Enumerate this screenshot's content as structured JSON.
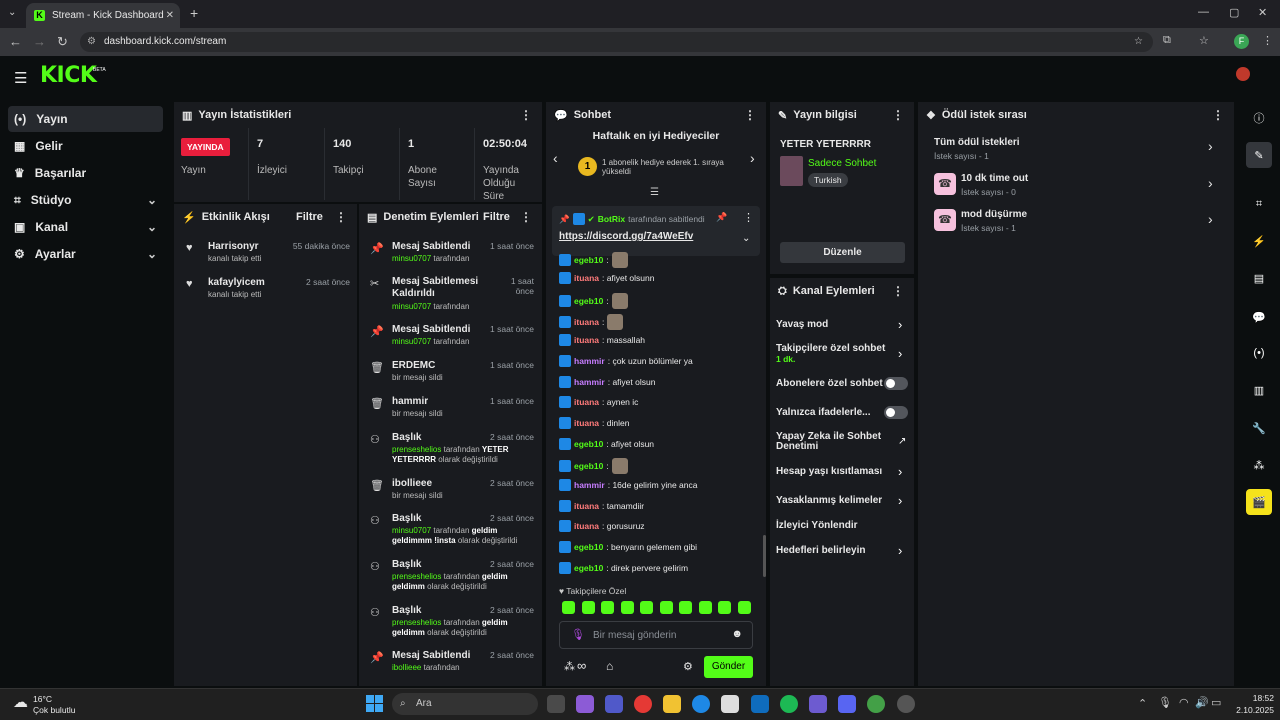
{
  "browser": {
    "tab_title": "Stream - Kick Dashboard",
    "url": "dashboard.kick.com/stream",
    "profile_initial": "F"
  },
  "header": {
    "logo": "KICK",
    "beta": "BETA"
  },
  "sidebar": {
    "items": [
      {
        "label": "Yayın",
        "icon": "broadcast-icon"
      },
      {
        "label": "Gelir",
        "icon": "revenue-icon"
      },
      {
        "label": "Başarılar",
        "icon": "trophy-icon"
      },
      {
        "label": "Stüdyo",
        "icon": "studio-icon"
      },
      {
        "label": "Kanal",
        "icon": "channel-icon"
      },
      {
        "label": "Ayarlar",
        "icon": "gear-icon"
      }
    ]
  },
  "stats": {
    "title": "Yayın İstatistikleri",
    "status": "YAYINDA",
    "status_label": "Yayın",
    "viewers": "7",
    "viewers_label": "İzleyici",
    "followers": "140",
    "followers_label": "Takipçi",
    "subs": "1",
    "subs_label": "Abone Sayısı",
    "uptime": "02:50:04",
    "uptime_label": "Yayında Olduğu Süre"
  },
  "activity": {
    "title": "Etkinlik Akışı",
    "filter": "Filtre",
    "items": [
      {
        "name": "Harrisonyr",
        "desc": "kanalı takip etti",
        "time": "55 dakika önce"
      },
      {
        "name": "kafaylyicem",
        "desc": "kanalı takip etti",
        "time": "2 saat önce"
      }
    ]
  },
  "modlog": {
    "title": "Denetim Eylemleri",
    "filter": "Filtre",
    "items": [
      {
        "title": "Mesaj Sabitlendi",
        "user": "minsu0707",
        "rest": "tarafından",
        "time": "1 saat önce"
      },
      {
        "title": "Mesaj Sabitlemesi Kaldırıldı",
        "user": "minsu0707",
        "rest": "tarafından",
        "time": "1 saat önce"
      },
      {
        "title": "Mesaj Sabitlendi",
        "user": "minsu0707",
        "rest": "tarafından",
        "time": "1 saat önce"
      },
      {
        "title": "ERDEMC",
        "rest": "bir mesajı sildi",
        "time": "1 saat önce"
      },
      {
        "title": "hammir",
        "rest": "bir mesajı sildi",
        "time": "1 saat önce"
      },
      {
        "title": "Başlık",
        "user": "prenseshelios",
        "rest": "tarafından",
        "bold": "YETER YETERRRR",
        "rest2": "olarak değiştirildi",
        "time": "2 saat önce"
      },
      {
        "title": "ibollieee",
        "rest": "bir mesajı sildi",
        "time": "2 saat önce"
      },
      {
        "title": "Başlık",
        "user": "minsu0707",
        "rest": "tarafından",
        "bold": "geldim geldimmm !insta",
        "rest2": "olarak değiştirildi",
        "time": "2 saat önce"
      },
      {
        "title": "Başlık",
        "user": "prenseshelios",
        "rest": "tarafından",
        "bold": "geldim geldimm",
        "rest2": "olarak değiştirildi",
        "time": "2 saat önce"
      },
      {
        "title": "Başlık",
        "user": "prenseshelios",
        "rest": "tarafından",
        "bold": "geldim geldimm",
        "rest2": "olarak değiştirildi",
        "time": "2 saat önce"
      },
      {
        "title": "Mesaj Sabitlendi",
        "user": "ibollieee",
        "rest": "tarafından",
        "time": "2 saat önce"
      }
    ]
  },
  "chat": {
    "title": "Sohbet",
    "gifters_title": "Haftalık en iyi Hediyeciler",
    "gifter_text": "1 abonelik hediye ederek 1. sıraya yükseldi",
    "pinned_user": "BotRix",
    "pinned_by": "tarafından sabitlendi",
    "pinned_link": "https://discord.gg/7a4WeEfv",
    "messages": [
      {
        "user": "egeb10",
        "color": "#53fc18",
        "text": ":",
        "emote": true
      },
      {
        "user": "ituana",
        "color": "#ff7b7b",
        "text": ": afiyet olsunn"
      },
      {
        "user": "egeb10",
        "color": "#53fc18",
        "text": ":",
        "emote": true
      },
      {
        "user": "ituana",
        "color": "#ff7b7b",
        "text": ":",
        "emote": true
      },
      {
        "user": "ituana",
        "color": "#ff7b7b",
        "text": ": massallah"
      },
      {
        "user": "hammir",
        "color": "#c77dff",
        "text": ": çok uzun bölümler ya"
      },
      {
        "user": "hammir",
        "color": "#c77dff",
        "text": ": afiyet olsun"
      },
      {
        "user": "ituana",
        "color": "#ff7b7b",
        "text": ": aynen ic"
      },
      {
        "user": "ituana",
        "color": "#ff7b7b",
        "text": ": dinlen"
      },
      {
        "user": "egeb10",
        "color": "#53fc18",
        "text": ": afiyet olsun"
      },
      {
        "user": "egeb10",
        "color": "#53fc18",
        "text": ":",
        "emote": true
      },
      {
        "user": "hammir",
        "color": "#c77dff",
        "text": ": 16de gelirim yine anca"
      },
      {
        "user": "ituana",
        "color": "#ff7b7b",
        "text": ": tamamdiir"
      },
      {
        "user": "ituana",
        "color": "#ff7b7b",
        "text": ": gorusuruz"
      },
      {
        "user": "egeb10",
        "color": "#53fc18",
        "text": ": benyarın gelemem gibi"
      },
      {
        "user": "egeb10",
        "color": "#53fc18",
        "text": ": direk pervere gelirim"
      }
    ],
    "followers_only": "Takipçilere Özel",
    "input_placeholder": "Bir mesaj gönderin",
    "send": "Gönder"
  },
  "stream_info": {
    "title": "Yayın bilgisi",
    "stream_title": "YETER YETERRRR",
    "category": "Sadece Sohbet",
    "language": "Turkish",
    "edit": "Düzenle"
  },
  "channel_actions": {
    "title": "Kanal Eylemleri",
    "items": [
      {
        "label": "Yavaş mod",
        "control": "arrow"
      },
      {
        "label": "Takipçilere özel sohbet",
        "sub": "1 dk.",
        "control": "arrow"
      },
      {
        "label": "Abonelere özel sohbet",
        "control": "toggle"
      },
      {
        "label": "Yalnızca ifadelerle...",
        "control": "toggle"
      },
      {
        "label": "Yapay Zeka ile Sohbet Denetimi",
        "control": "external"
      },
      {
        "label": "Hesap yaşı kısıtlaması",
        "control": "arrow"
      },
      {
        "label": "Yasaklanmış kelimeler",
        "control": "arrow"
      },
      {
        "label": "İzleyici Yönlendir",
        "control": "none"
      },
      {
        "label": "Hedefleri belirleyin",
        "control": "arrow"
      }
    ]
  },
  "rewards": {
    "title": "Ödül istek sırası",
    "items": [
      {
        "label": "Tüm ödül istekleri",
        "count": "İstek sayısı - 1"
      },
      {
        "label": "10 dk time out",
        "count": "İstek sayısı - 0"
      },
      {
        "label": "mod düşürme",
        "count": "İstek sayısı - 1"
      }
    ]
  },
  "taskbar": {
    "weather_temp": "16°C",
    "weather_desc": "Çok bulutlu",
    "search": "Ara",
    "time": "18:52",
    "date": "2.10.2025"
  },
  "colors": {
    "accent": "#53fc18",
    "live": "#e91e3c",
    "panel": "#191b1f"
  }
}
